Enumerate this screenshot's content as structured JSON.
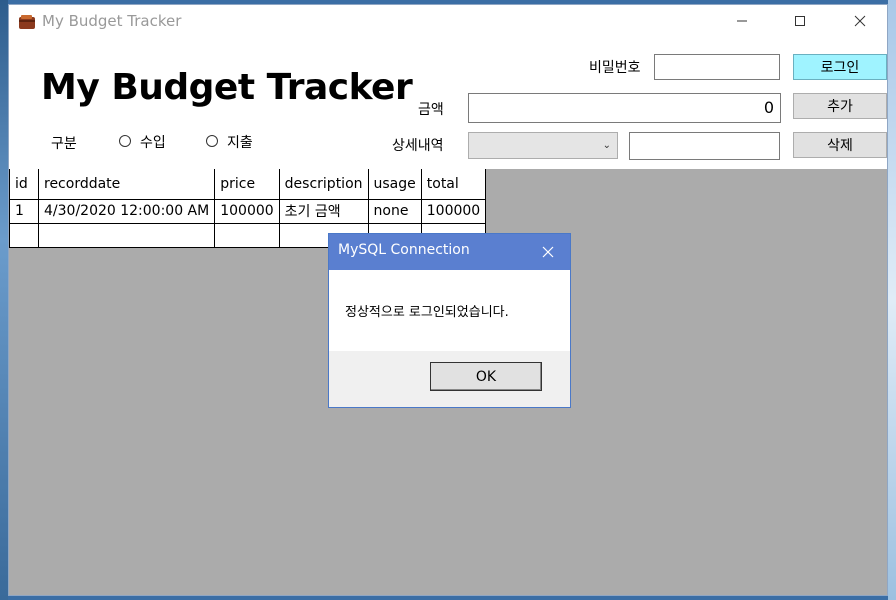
{
  "window": {
    "title": "My Budget Tracker",
    "icon": "wallet-icon"
  },
  "header": {
    "heading": "My Budget Tracker",
    "password_label": "비밀번호",
    "password_value": "",
    "login_button": "로그인",
    "amount_label": "금액",
    "amount_value": "0",
    "add_button": "추가",
    "detail_label": "상세내역",
    "detail_select_value": "",
    "detail_text_value": "",
    "delete_button": "삭제",
    "category_label": "구분",
    "income_label": "수입",
    "expense_label": "지출"
  },
  "grid": {
    "columns": [
      "id",
      "recorddate",
      "price",
      "description",
      "usage",
      "total"
    ],
    "rows": [
      [
        "1",
        "4/30/2020 12:00:00 AM",
        "100000",
        "초기 금액",
        "none",
        "100000"
      ],
      [
        "",
        "",
        "",
        "",
        "",
        ""
      ]
    ]
  },
  "dialog": {
    "title": "MySQL Connection",
    "message": "정상적으로 로그인되었습니다.",
    "ok_button": "OK"
  },
  "colors": {
    "login_button_bg": "#9ff3ff",
    "dialog_title_bg": "#5a7fd0"
  }
}
